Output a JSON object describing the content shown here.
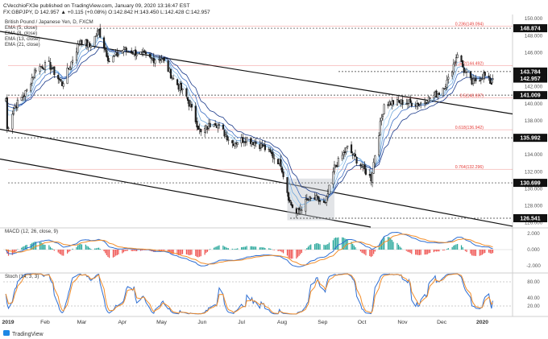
{
  "header": {
    "author_line": "CVecchioFX3e published on TradingView.com, January 09, 2020 13:16:47 EST",
    "symbol_line": "FX:GBPJPY, D  142.957  ▲ +0.115 (+0.08%)  O:142.842  H:143.450  L:142.428  C:142.957"
  },
  "legend": {
    "title": "British Pound / Japanese Yen, D, FXCM",
    "ema5": "EMA (5, close)",
    "ema8": "EMA (8, close)",
    "ema13": "EMA (13, close)",
    "ema21": "EMA (21, close)"
  },
  "colors": {
    "up": "#ffffff",
    "down": "#222222",
    "ema5": "#a9d4f5",
    "ema8": "#6fa8dc",
    "ema13": "#3d6fc4",
    "ema21": "#1b3a8a",
    "macd_line": "#2f6fd3",
    "signal_line": "#f28c28",
    "hist_up": "#26a69a",
    "hist_down": "#ef5350",
    "stoch_k": "#2f6fd3",
    "stoch_d": "#f28c28",
    "fib": "#e53935",
    "price_tag": "#111111"
  },
  "price_axis": {
    "ticks": [
      "150.000",
      "148.000",
      "146.000",
      "144.000",
      "142.000",
      "140.000",
      "138.000",
      "136.000",
      "134.000",
      "132.000",
      "130.000",
      "128.000",
      "126.000"
    ],
    "labels": [
      {
        "name": "level-148874",
        "text": "148.874",
        "value": 148.874
      },
      {
        "name": "level-143784",
        "text": "143.784",
        "value": 143.784
      },
      {
        "name": "current-price",
        "text": "142.957",
        "value": 142.957,
        "current": true
      },
      {
        "name": "level-141009",
        "text": "141.009",
        "value": 141.009
      },
      {
        "name": "level-135992",
        "text": "135.992",
        "value": 135.992
      },
      {
        "name": "level-130699",
        "text": "130.699",
        "value": 130.699
      },
      {
        "name": "level-126541",
        "text": "126.541",
        "value": 126.541
      }
    ]
  },
  "fib_levels": [
    {
      "text": "0.236(149.094)",
      "value": 149.094
    },
    {
      "text": "0.382(144.492)",
      "value": 144.492
    },
    {
      "text": "0.5(140.697)",
      "value": 140.697
    },
    {
      "text": "0.618(136.942)",
      "value": 136.942
    },
    {
      "text": "0.764(132.296)",
      "value": 132.296
    }
  ],
  "macd": {
    "title": "MACD (12, 26, close, 9)",
    "ticks": [
      "2.000",
      "0.000",
      "-2.000"
    ]
  },
  "stoch": {
    "title": "Stoch (14, 3, 3)",
    "ticks": [
      "80.00",
      "40.00",
      "20.00"
    ]
  },
  "time_axis": {
    "labels": [
      "2019",
      "Feb",
      "Mar",
      "Apr",
      "May",
      "Jun",
      "Jul",
      "Aug",
      "Sep",
      "Oct",
      "Nov",
      "Dec",
      "2020"
    ]
  },
  "footer": {
    "brand": "TradingView"
  },
  "chart_data": {
    "type": "candlestick",
    "title": "British Pound / Japanese Yen, D, FXCM",
    "x": [
      "2019-01",
      "2019-02",
      "2019-03",
      "2019-04",
      "2019-05",
      "2019-06",
      "2019-07",
      "2019-08",
      "2019-09",
      "2019-10",
      "2019-11",
      "2019-12",
      "2020-01"
    ],
    "price_path": [
      [
        "2019-01-02",
        140.6
      ],
      [
        "2019-01-03",
        137.0
      ],
      [
        "2019-01-08",
        139.5
      ],
      [
        "2019-01-18",
        141.5
      ],
      [
        "2019-01-25",
        144.2
      ],
      [
        "2019-02-04",
        144.6
      ],
      [
        "2019-02-14",
        142.3
      ],
      [
        "2019-02-20",
        144.5
      ],
      [
        "2019-02-28",
        147.5
      ],
      [
        "2019-03-07",
        146.8
      ],
      [
        "2019-03-14",
        148.6
      ],
      [
        "2019-03-22",
        145.0
      ],
      [
        "2019-04-02",
        146.4
      ],
      [
        "2019-04-16",
        145.8
      ],
      [
        "2019-04-23",
        145.2
      ],
      [
        "2019-05-01",
        145.4
      ],
      [
        "2019-05-10",
        142.9
      ],
      [
        "2019-05-20",
        140.8
      ],
      [
        "2019-05-31",
        136.5
      ],
      [
        "2019-06-10",
        138.0
      ],
      [
        "2019-06-24",
        135.4
      ],
      [
        "2019-07-05",
        135.9
      ],
      [
        "2019-07-17",
        135.0
      ],
      [
        "2019-07-31",
        133.0
      ],
      [
        "2019-08-07",
        128.4
      ],
      [
        "2019-08-12",
        127.1
      ],
      [
        "2019-08-20",
        128.6
      ],
      [
        "2019-08-27",
        128.8
      ],
      [
        "2019-09-03",
        128.1
      ],
      [
        "2019-09-10",
        132.5
      ],
      [
        "2019-09-20",
        134.8
      ],
      [
        "2019-09-30",
        132.8
      ],
      [
        "2019-10-08",
        131.2
      ],
      [
        "2019-10-12",
        135.0
      ],
      [
        "2019-10-18",
        140.0
      ],
      [
        "2019-10-31",
        140.2
      ],
      [
        "2019-11-14",
        140.0
      ],
      [
        "2019-11-29",
        141.3
      ],
      [
        "2019-12-06",
        142.8
      ],
      [
        "2019-12-13",
        146.0
      ],
      [
        "2019-12-18",
        143.9
      ],
      [
        "2019-12-24",
        142.4
      ],
      [
        "2020-01-02",
        143.4
      ],
      [
        "2020-01-08",
        142.4
      ],
      [
        "2020-01-09",
        142.957
      ]
    ],
    "last": {
      "open": 142.842,
      "high": 143.45,
      "low": 142.428,
      "close": 142.957,
      "change": 0.115,
      "change_pct": 0.08
    },
    "horizontal_levels": [
      148.874,
      143.784,
      141.009,
      135.992,
      130.699,
      126.541
    ],
    "ylim": [
      125.5,
      150.3
    ],
    "macd_ylim": [
      -2.8,
      2.6
    ],
    "stoch_ylim": [
      0,
      100
    ]
  }
}
